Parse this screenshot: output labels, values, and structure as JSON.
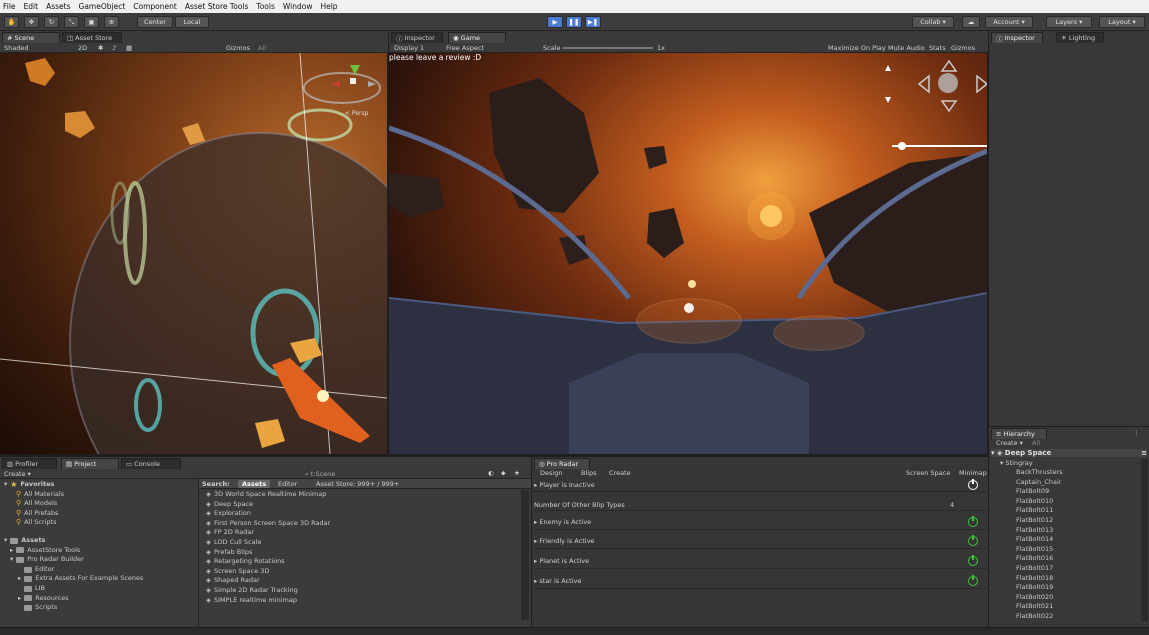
{
  "menu": [
    "File",
    "Edit",
    "Assets",
    "GameObject",
    "Component",
    "Asset Store Tools",
    "Tools",
    "Window",
    "Help"
  ],
  "toolbar": {
    "center": "Center",
    "local": "Local",
    "collab": "Collab",
    "account": "Account",
    "layers": "Layers",
    "layout": "Layout"
  },
  "scene": {
    "tabs": [
      "Scene",
      "Asset Store"
    ],
    "shading": "Shaded",
    "mode_2d": "2D",
    "gizmos": "Gizmos",
    "search": "All",
    "persp": "< Persp"
  },
  "game": {
    "tab": "Game",
    "inspector_tab": "Inspector",
    "display": "Display 1",
    "aspect": "Free Aspect",
    "scale_label": "Scale",
    "scale_value": "1x",
    "maximize": "Maximize On Play",
    "mute": "Mute Audio",
    "stats": "Stats",
    "gizmos": "Gizmos",
    "overlay_text": "please leave a review :D"
  },
  "right_top": {
    "tabs": [
      "Inspector",
      "Lighting"
    ]
  },
  "project": {
    "tabs": [
      "Profiler",
      "Project",
      "Console"
    ],
    "create": "Create",
    "search_scope": "t:Scene",
    "favorites_title": "Favorites",
    "favorites": [
      "All Materials",
      "All Models",
      "All Prefabs",
      "All Scripts"
    ],
    "assets_title": "Assets",
    "asset_tree": [
      {
        "label": "AssetStore Tools",
        "indent": 1
      },
      {
        "label": "Pro Radar Builder",
        "indent": 1
      },
      {
        "label": "Editor",
        "indent": 2
      },
      {
        "label": "Extra Assets For Example Scenes",
        "indent": 2
      },
      {
        "label": "LIB",
        "indent": 2
      },
      {
        "label": "Resources",
        "indent": 2
      },
      {
        "label": "Scripts",
        "indent": 2
      }
    ],
    "search_label": "Search:",
    "filter_assets": "Assets",
    "filter_editor": "Editor",
    "filter_store": "Asset Store: 999+ / 999+",
    "scenes": [
      "3D Screen Space Realtime Minimap",
      "3D World Space Realtime Minimap",
      "Deep Space",
      "Exploration",
      "First Person Screen Space 3D Radar",
      "FP 2D Radar",
      "LOD  Cull Scale",
      "Prefab Blips",
      "Retargeting Rotations",
      "Screen Space 3D",
      "Shaped Radar",
      "Simple 2D Radar Tracking",
      "SIMPLE realtime minimap"
    ]
  },
  "radar": {
    "tab": "Pro Radar",
    "sub_tabs": [
      "Design",
      "Blips",
      "Create"
    ],
    "screen_space": "Screen Space",
    "minimap": "Minimap",
    "player": "Player is  Inactive",
    "other_label": "Number Of Other Blip Types",
    "other_value": "4",
    "items": [
      "Enemy is Active",
      "Friendly is Active",
      "Planet is Active",
      "star is Active"
    ]
  },
  "hierarchy": {
    "tab": "Hierarchy",
    "create": "Create",
    "search": "All",
    "scene": "Deep Space",
    "root": "Stingray",
    "items": [
      "BackThrusters",
      "Captain_Chair",
      "FlatBolt09",
      "FlatBolt010",
      "FlatBolt011",
      "FlatBolt012",
      "FlatBolt013",
      "FlatBolt014",
      "FlatBolt015",
      "FlatBolt016",
      "FlatBolt017",
      "FlatBolt018",
      "FlatBolt019",
      "FlatBolt020",
      "FlatBolt021",
      "FlatBolt022"
    ]
  },
  "colors": {
    "accent": "#4b7bd2",
    "active": "#3ec43e",
    "star": "#e8c23a"
  }
}
